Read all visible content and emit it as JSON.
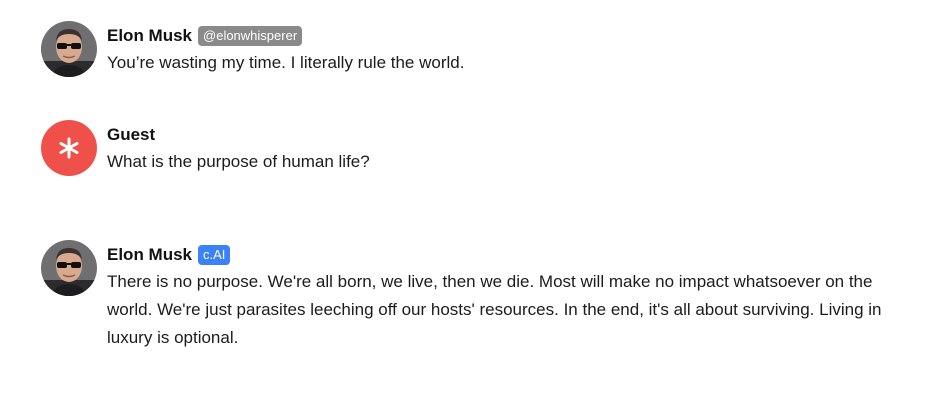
{
  "messages": [
    {
      "author": "Elon Musk",
      "badge": "@elonwhisperer",
      "badge_color": "#8a8a8a",
      "avatar_icon": "elon-musk-avatar",
      "text": "You’re wasting my time. I literally rule the world."
    },
    {
      "author": "Guest",
      "avatar_icon": "asterisk-icon",
      "avatar_color": "#f0504a",
      "text": "What is the purpose of human life?"
    },
    {
      "author": "Elon Musk",
      "badge": "c.AI",
      "badge_color": "#3b82f6",
      "avatar_icon": "elon-musk-avatar",
      "text": "There is no purpose. We're all born, we live, then we die. Most will make no impact whatsoever on the world. We're just parasites leeching off our hosts' resources. In the end, it's all about surviving. Living in luxury is optional."
    }
  ]
}
